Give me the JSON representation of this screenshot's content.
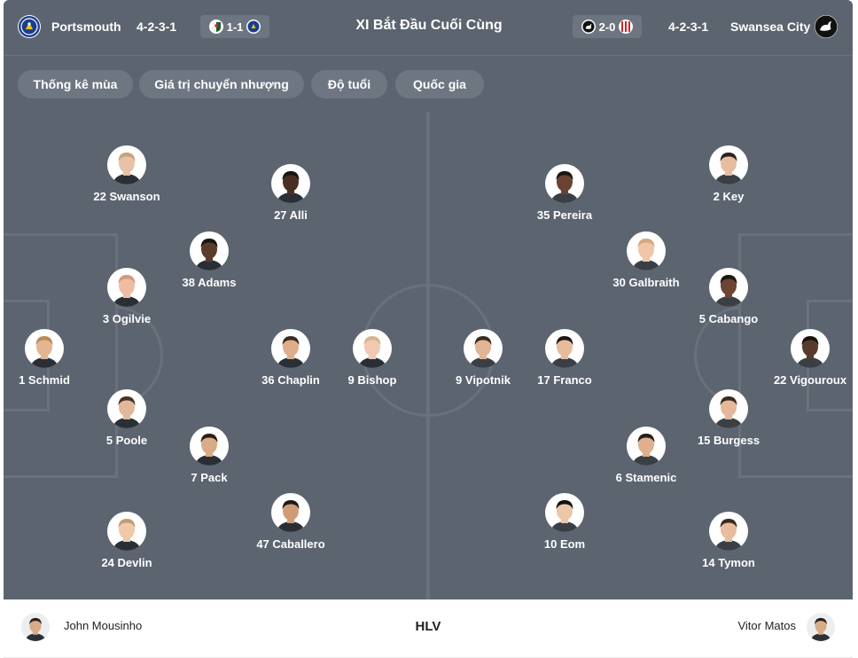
{
  "header": {
    "home_team": "Portsmouth",
    "home_formation": "4-2-3-1",
    "home_recent_score": "1-1",
    "title": "XI Bắt Đầu Cuối Cùng",
    "away_recent_score": "2-0",
    "away_formation": "4-2-3-1",
    "away_team": "Swansea City"
  },
  "tabs": [
    "Thống kê mùa",
    "Giá trị chuyển nhượng",
    "Độ tuổi",
    "Quốc gia"
  ],
  "home_players": [
    {
      "label": "22 Swanson",
      "skin": "#e7c2a6",
      "hair": "#c9a27a"
    },
    {
      "label": "27 Alli",
      "skin": "#4a2e22",
      "hair": "#1a1410"
    },
    {
      "label": "38 Adams",
      "skin": "#5b3b2a",
      "hair": "#1c1612"
    },
    {
      "label": "3 Ogilvie",
      "skin": "#efbda4",
      "hair": "#d49a7e"
    },
    {
      "label": "1 Schmid",
      "skin": "#e3b591",
      "hair": "#b98a55"
    },
    {
      "label": "36 Chaplin",
      "skin": "#deae8c",
      "hair": "#3a2b20"
    },
    {
      "label": "9 Bishop",
      "skin": "#f0c9b0",
      "hair": "#d6b48c"
    },
    {
      "label": "5 Poole",
      "skin": "#e2b89a",
      "hair": "#4a3424"
    },
    {
      "label": "7 Pack",
      "skin": "#d9ab86",
      "hair": "#2a1f18"
    },
    {
      "label": "47 Caballero",
      "skin": "#cf9c78",
      "hair": "#1f1814"
    },
    {
      "label": "24 Devlin",
      "skin": "#f0c8aa",
      "hair": "#c79b6e"
    }
  ],
  "away_players": [
    {
      "label": "35 Pereira",
      "skin": "#6a4330",
      "hair": "#1c1612"
    },
    {
      "label": "2 Key",
      "skin": "#e6bda0",
      "hair": "#2e2018"
    },
    {
      "label": "30 Galbraith",
      "skin": "#f0c5a8",
      "hair": "#d4a880"
    },
    {
      "label": "5 Cabango",
      "skin": "#6b4532",
      "hair": "#1c1612"
    },
    {
      "label": "9 Vipotnik",
      "skin": "#e2b596",
      "hair": "#3a2b20"
    },
    {
      "label": "17 Franco",
      "skin": "#e6bc9c",
      "hair": "#1e1814"
    },
    {
      "label": "22 Vigouroux",
      "skin": "#5a3a2a",
      "hair": "#18120e"
    },
    {
      "label": "15 Burgess",
      "skin": "#e4b898",
      "hair": "#3b2a1e"
    },
    {
      "label": "6 Stamenic",
      "skin": "#deb08e",
      "hair": "#2a1f18"
    },
    {
      "label": "10 Eom",
      "skin": "#ecc6a6",
      "hair": "#141010"
    },
    {
      "label": "14 Tymon",
      "skin": "#e8bc9e",
      "hair": "#3a2a1e"
    }
  ],
  "footer": {
    "home_coach": "John Mousinho",
    "label": "HLV",
    "away_coach": "Vitor Matos"
  },
  "icons": {
    "home_logo": "portsmouth-crest-icon",
    "away_logo": "swansea-swan-icon",
    "recent_home_opponent": "blackburn-crest-icon",
    "recent_away_opponent": "stoke-crest-icon"
  },
  "colors": {
    "panel": "#5c6470",
    "pitch_lines": "#69717c",
    "tab": "#6e7682",
    "portsmouth_blue": "#1b3f8f",
    "stoke_red": "#d2232a"
  }
}
